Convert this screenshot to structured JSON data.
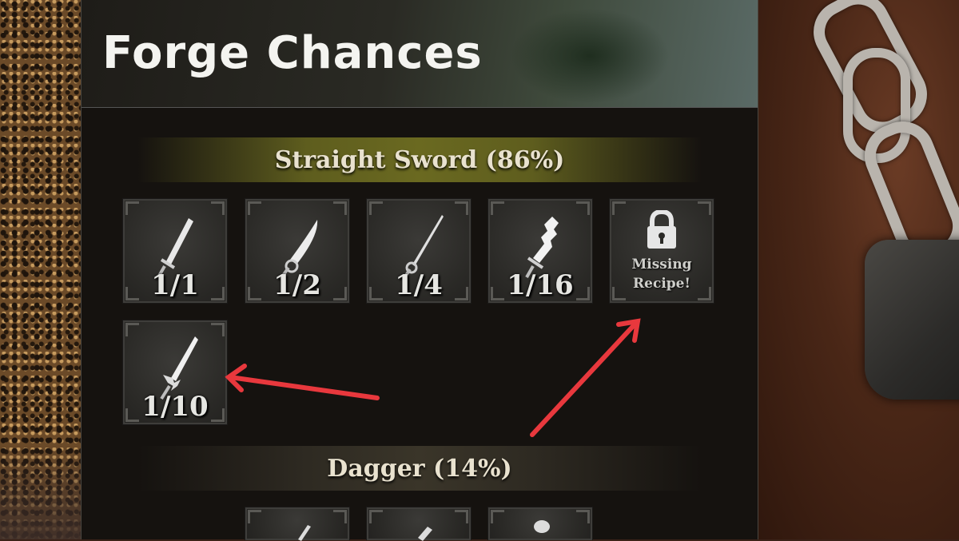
{
  "title": "Forge Chances",
  "categories": [
    {
      "name": "Straight Sword (86%)",
      "items": [
        {
          "icon": "longsword-icon",
          "ratio": "1/1"
        },
        {
          "icon": "curved-sword-icon",
          "ratio": "1/2"
        },
        {
          "icon": "rapier-icon",
          "ratio": "1/4"
        },
        {
          "icon": "serrated-sword-icon",
          "ratio": "1/16"
        },
        {
          "icon": "lock-icon",
          "status_line1": "Missing",
          "status_line2": "Recipe!"
        },
        {
          "icon": "crystal-sword-icon",
          "ratio": "1/10"
        }
      ]
    },
    {
      "name": "Dagger (14%)",
      "items": [
        {
          "icon": "dagger-icon"
        },
        {
          "icon": "dagger-icon"
        },
        {
          "icon": "dagger-icon"
        }
      ]
    }
  ],
  "annotations": {
    "arrow_color": "#e8383d",
    "arrows": [
      "pointer to 1/10 slot",
      "pointer to Missing Recipe slot"
    ]
  }
}
